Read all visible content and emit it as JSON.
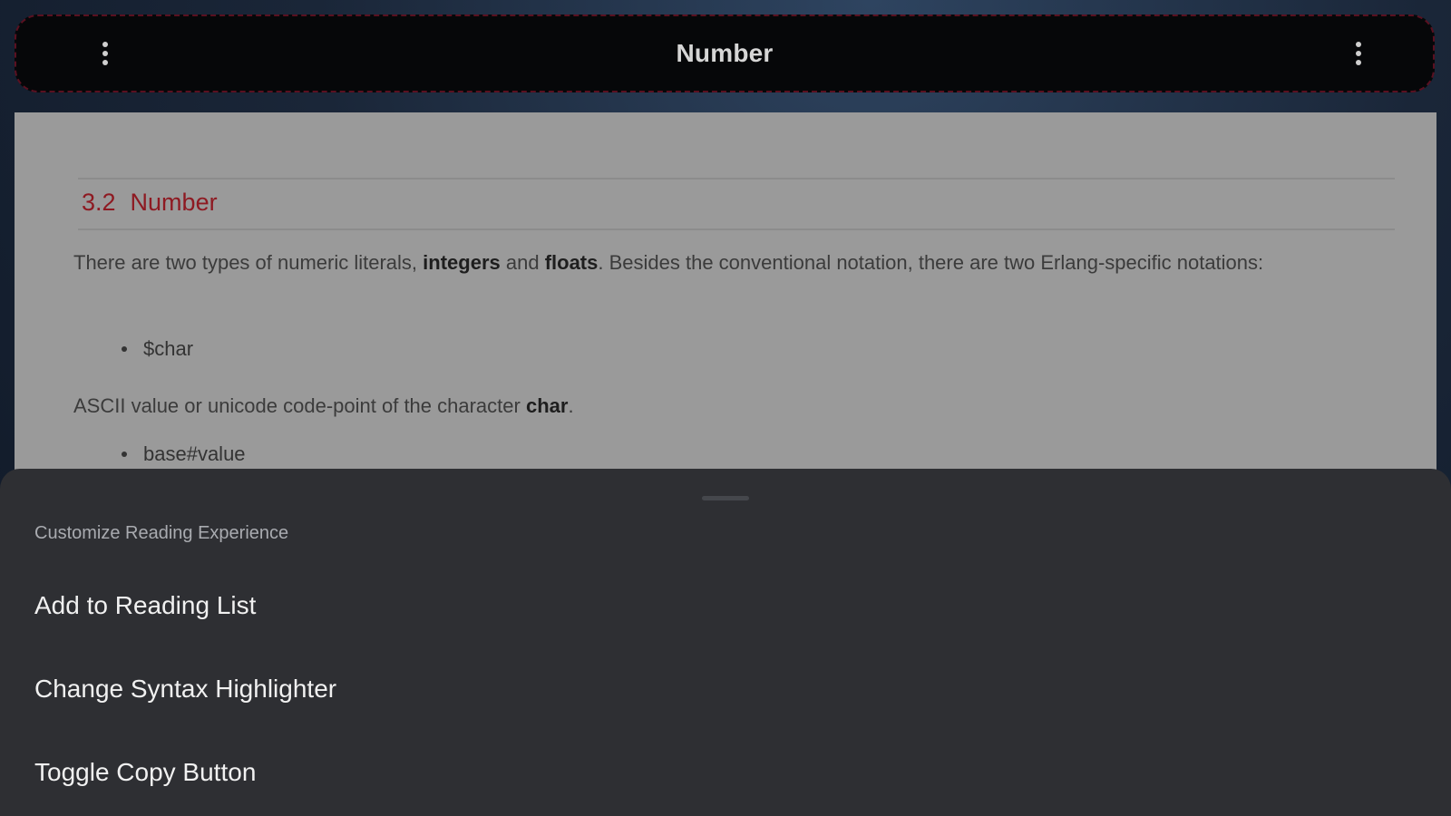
{
  "appbar": {
    "title": "Number",
    "left_menu_icon": "more-vert-icon",
    "right_menu_icon": "more-vert-icon"
  },
  "content": {
    "section_number": "3.2",
    "section_title": "Number",
    "para1_pre": "There are two types of numeric literals, ",
    "para1_bold1": "integers",
    "para1_mid": " and ",
    "para1_bold2": "floats",
    "para1_post": ". Besides the conventional notation, there are two Erlang-specific notations:",
    "bullet1": "$char",
    "para2_pre": "ASCII value or unicode code-point of the character ",
    "para2_bold": "char",
    "para2_post": ".",
    "bullet2": "base#value"
  },
  "sheet": {
    "title": "Customize Reading Experience",
    "items": [
      {
        "label": "Add to Reading List"
      },
      {
        "label": "Change Syntax Highlighter"
      },
      {
        "label": "Toggle Copy Button"
      }
    ]
  },
  "colors": {
    "heading_red": "#8e1a22",
    "sheet_bg": "#2e2f33",
    "appbar_bg": "#060709"
  }
}
